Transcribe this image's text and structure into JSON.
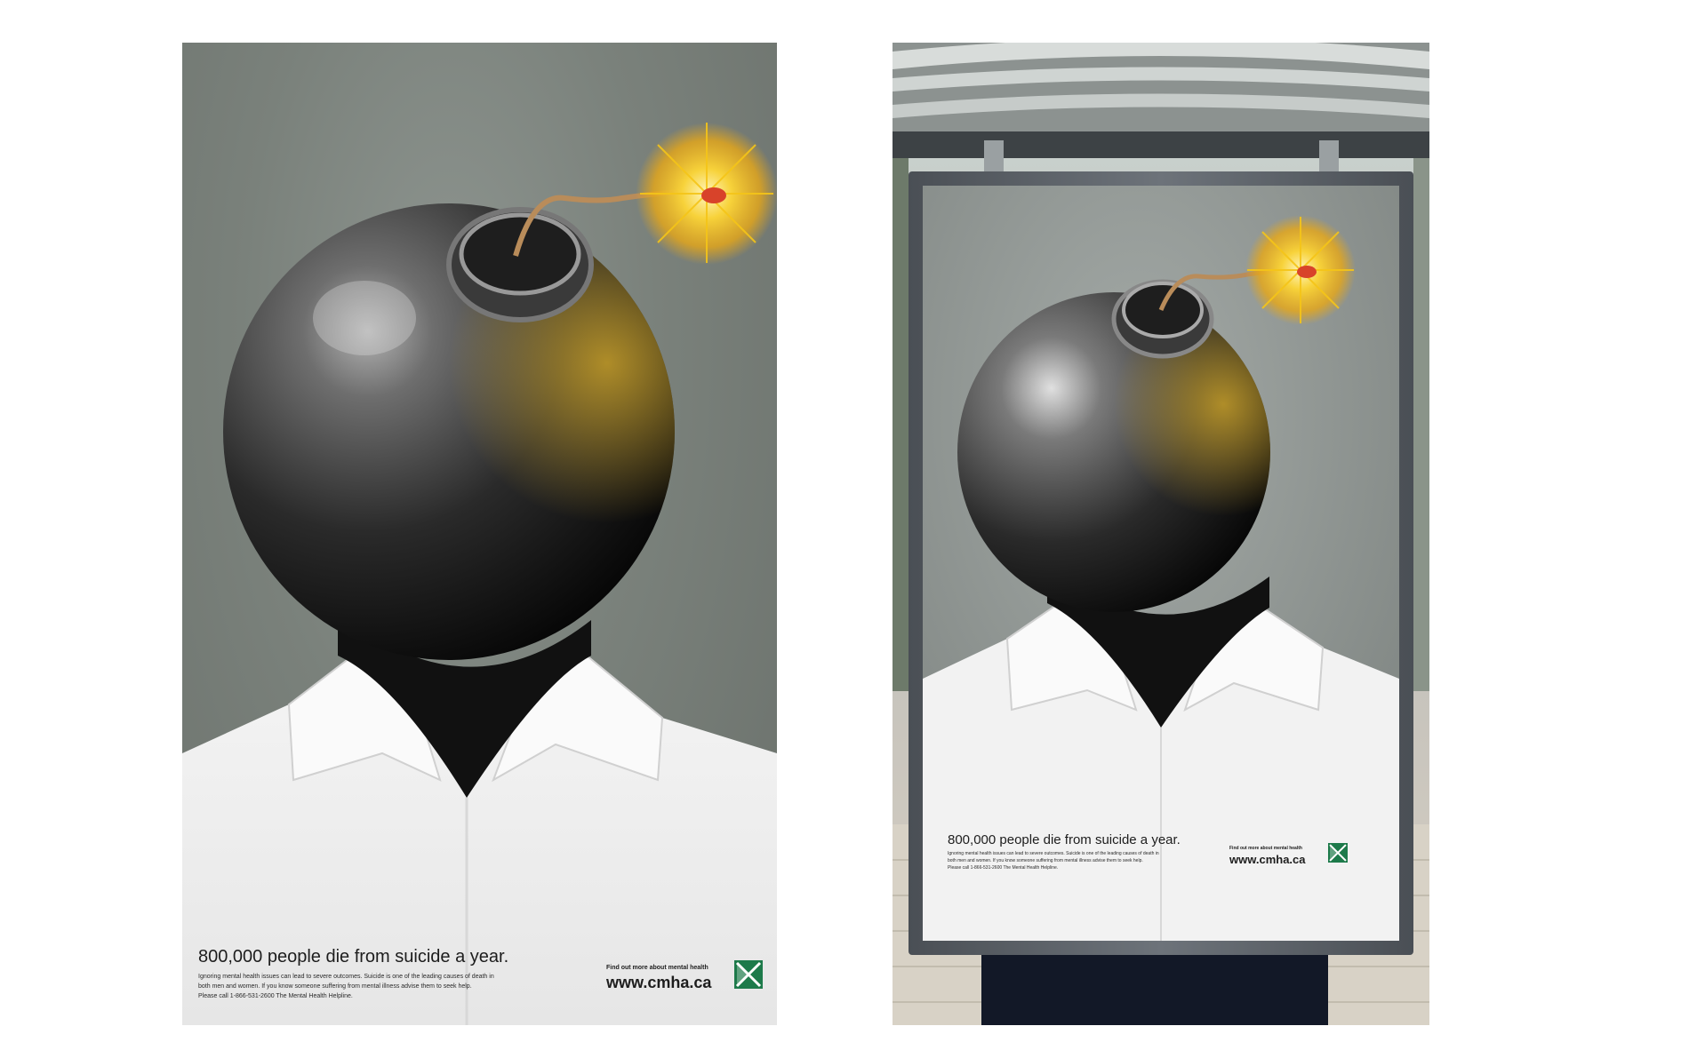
{
  "poster": {
    "headline": "800,000 people die from suicide a year.",
    "body_line1": "Ignoring mental health issues can lead to severe outcomes. Suicide is one of the leading causes of death in",
    "body_line2": "both men and women. If you know someone suffering from mental illness advise them to seek help.",
    "body_line3": "Please call 1-866-531-2600 The Mental Health Helpline.",
    "cta_small": "Find out more about mental health",
    "url": "www.cmha.ca"
  },
  "shelter_poster": {
    "headline": "800,000 people die from suicide a year.",
    "body_line1": "Ignoring mental health issues can lead to severe outcomes. Suicide is one of the leading causes of death in",
    "body_line2": "both men and women. If you know someone suffering from mental illness advise them to seek help.",
    "body_line3": "Please call 1-866-531-2600 The Mental Health Helpline.",
    "cta_small": "Find out more about mental health",
    "url": "www.cmha.ca"
  },
  "colors": {
    "logo_green": "#1d7a4a",
    "backdrop_gray": "#7a817b",
    "bomb_black": "#1a1a1a",
    "spark_yellow": "#f2c21c"
  },
  "icons": [
    "bomb-illustration",
    "cmha-logo-icon",
    "spark-icon"
  ]
}
